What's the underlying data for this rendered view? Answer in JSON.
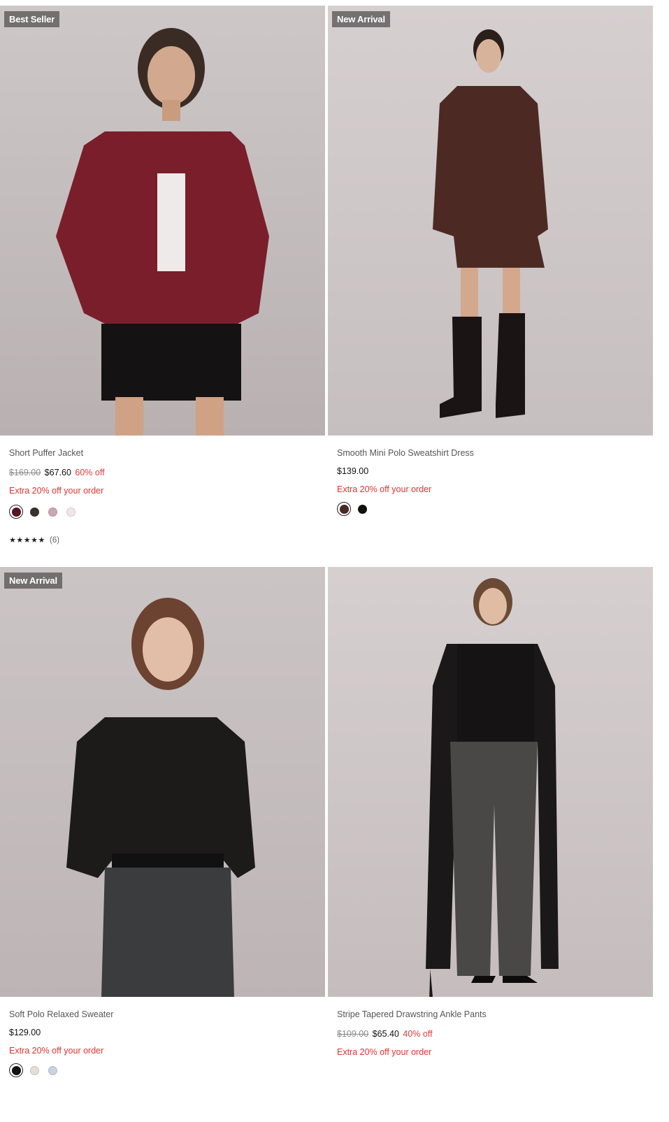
{
  "products": [
    {
      "badge": "Best Seller",
      "name": "Short Puffer Jacket",
      "original_price": "$169.00",
      "sale_price": "$67.60",
      "discount": "60% off",
      "promo": "Extra 20% off your order",
      "swatches": [
        "#5a1620",
        "#3a302f",
        "#c8aaae",
        "#f1e6e6"
      ],
      "selected_swatch": 0,
      "rating_stars": "★★★★★",
      "rating_count": "(6)"
    },
    {
      "badge": "New Arrival",
      "name": "Smooth Mini Polo Sweatshirt Dress",
      "price": "$139.00",
      "promo": "Extra 20% off your order",
      "swatches": [
        "#4a2a22",
        "#141010"
      ],
      "selected_swatch": 0
    },
    {
      "badge": "New Arrival",
      "name": "Soft Polo Relaxed Sweater",
      "price": "$129.00",
      "promo": "Extra 20% off your order",
      "swatches": [
        "#111111",
        "#e6ddd6",
        "#cbd3e0"
      ],
      "selected_swatch": 0
    },
    {
      "name": "Stripe Tapered Drawstring Ankle Pants",
      "original_price": "$109.00",
      "sale_price": "$65.40",
      "discount": "40% off",
      "promo": "Extra 20% off your order"
    }
  ],
  "colors": {
    "promo_red": "#e0332f",
    "badge_bg": "#5f5c5c",
    "photo_backdrop": "#c9c2c3"
  }
}
